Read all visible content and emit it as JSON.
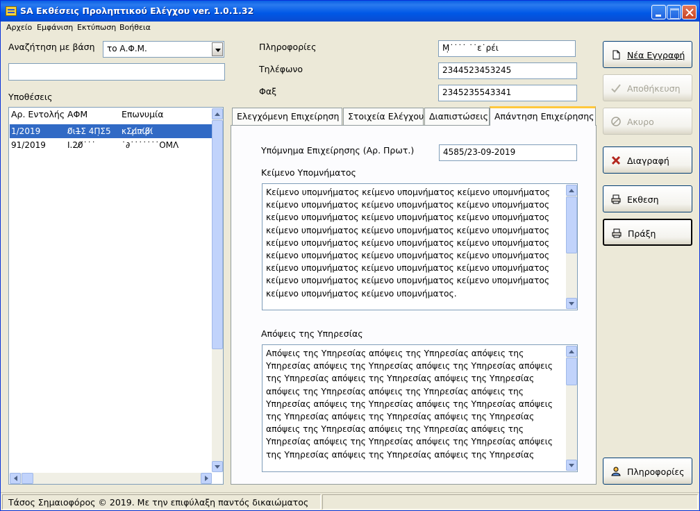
{
  "window": {
    "title": "SA Εκθέσεις Προληπτικού Ελέγχου ver. 1.0.1.32"
  },
  "menu": [
    "Αρχείο",
    "Εμφάνιση",
    "Εκτύπωση",
    "Βοήθεια"
  ],
  "search": {
    "label": "Αναζήτηση με βάση",
    "combo_value": "το Α.Φ.Μ.",
    "input_value": ""
  },
  "list": {
    "label": "Υποθέσεις",
    "columns": [
      "Αρ. Εντολής",
      "ΑΦΜ",
      "Επωνυμία"
    ],
    "rows": [
      {
        "order": "1/2019",
        "afm": "0̸ι1̶Σ 4Π̣Σ5",
        "name": "κΣμ̸̸πι̸β̸ι̸",
        "selected": true
      },
      {
        "order": "91/2019",
        "afm": "Ӏ.20̸̸˙˙˙",
        "name": "˙∂˙˙˙˙˙˙˙ΟΜΛ",
        "selected": false
      }
    ]
  },
  "info": {
    "info_label": "Πληροφορίες",
    "info_value": "Μ̣˙˙˙˙  ˙˙ε˙ρέι",
    "phone_label": "Τηλέφωνο",
    "phone_value": "2344523453245",
    "fax_label": "Φαξ",
    "fax_value": "2345235543341"
  },
  "tabs": [
    {
      "label": "Ελεγχόμενη Επιχείρηση",
      "active": false
    },
    {
      "label": "Στοιχεία Ελέγχου",
      "active": false
    },
    {
      "label": "Διαπιστώσεις",
      "active": false
    },
    {
      "label": "Απάντηση Επιχείρησης",
      "active": true
    }
  ],
  "answer": {
    "memo_label": "Υπόμνημα Επιχείρησης (Αρ. Πρωτ.)",
    "memo_value": "4585/23-09-2019",
    "memo_text_label": "Κείμενο Υπομνήματος",
    "memo_text_lines": [
      "Κείμενο υπομνήματος κείμενο υπομνήματος κείμενο υπομνήματος",
      "κείμενο υπομνήματος κείμενο υπομνήματος κείμενο υπομνήματος",
      "κείμενο υπομνήματος κείμενο υπομνήματος κείμενο υπομνήματος",
      "κείμενο υπομνήματος κείμενο υπομνήματος κείμενο υπομνήματος",
      "κείμενο υπομνήματος κείμενο υπομνήματος κείμενο υπομνήματος",
      "κείμενο υπομνήματος κείμενο υπομνήματος κείμενο υπομνήματος",
      "κείμενο υπομνήματος κείμενο υπομνήματος κείμενο υπομνήματος",
      "κείμενο υπομνήματος κείμενο υπομνήματος κείμενο υπομνήματος",
      "κείμενο υπομνήματος κείμενο υπομνήματος."
    ],
    "views_label": "Απόψεις της Υπηρεσίας",
    "views_lines": [
      "Απόψεις της Υπηρεσίας απόψεις της Υπηρεσίας απόψεις της",
      "Υπηρεσίας απόψεις της Υπηρεσίας απόψεις της Υπηρεσίας απόψεις",
      "της Υπηρεσίας απόψεις της Υπηρεσίας απόψεις της Υπηρεσίας",
      "απόψεις της Υπηρεσίας απόψεις της Υπηρεσίας απόψεις της",
      "Υπηρεσίας απόψεις της Υπηρεσίας απόψεις της Υπηρεσίας απόψεις",
      "της Υπηρεσίας απόψεις της Υπηρεσίας απόψεις της Υπηρεσίας",
      "απόψεις της Υπηρεσίας απόψεις της Υπηρεσίας απόψεις της",
      "Υπηρεσίας απόψεις της Υπηρεσίας απόψεις της Υπηρεσίας απόψεις",
      "της Υπηρεσίας απόψεις της Υπηρεσίας απόψεις της Υπηρεσίας"
    ]
  },
  "buttons": {
    "new_record": "Νέα Εγγραφή",
    "save": "Αποθήκευση",
    "cancel": "Ακυρο",
    "delete": "Διαγραφή",
    "report": "Εκθεση",
    "act": "Πράξη",
    "about": "Πληροφορίες"
  },
  "status": {
    "copyright": "Τάσος Σημαιοφόρος © 2019. Με την επιφύλαξη παντός δικαιώματος",
    "second": ""
  },
  "colors": {
    "selection": "#316ac5",
    "titlebar": "#0058e6",
    "delete_icon": "#b3261e",
    "tab_highlight": "#ffc83c"
  }
}
